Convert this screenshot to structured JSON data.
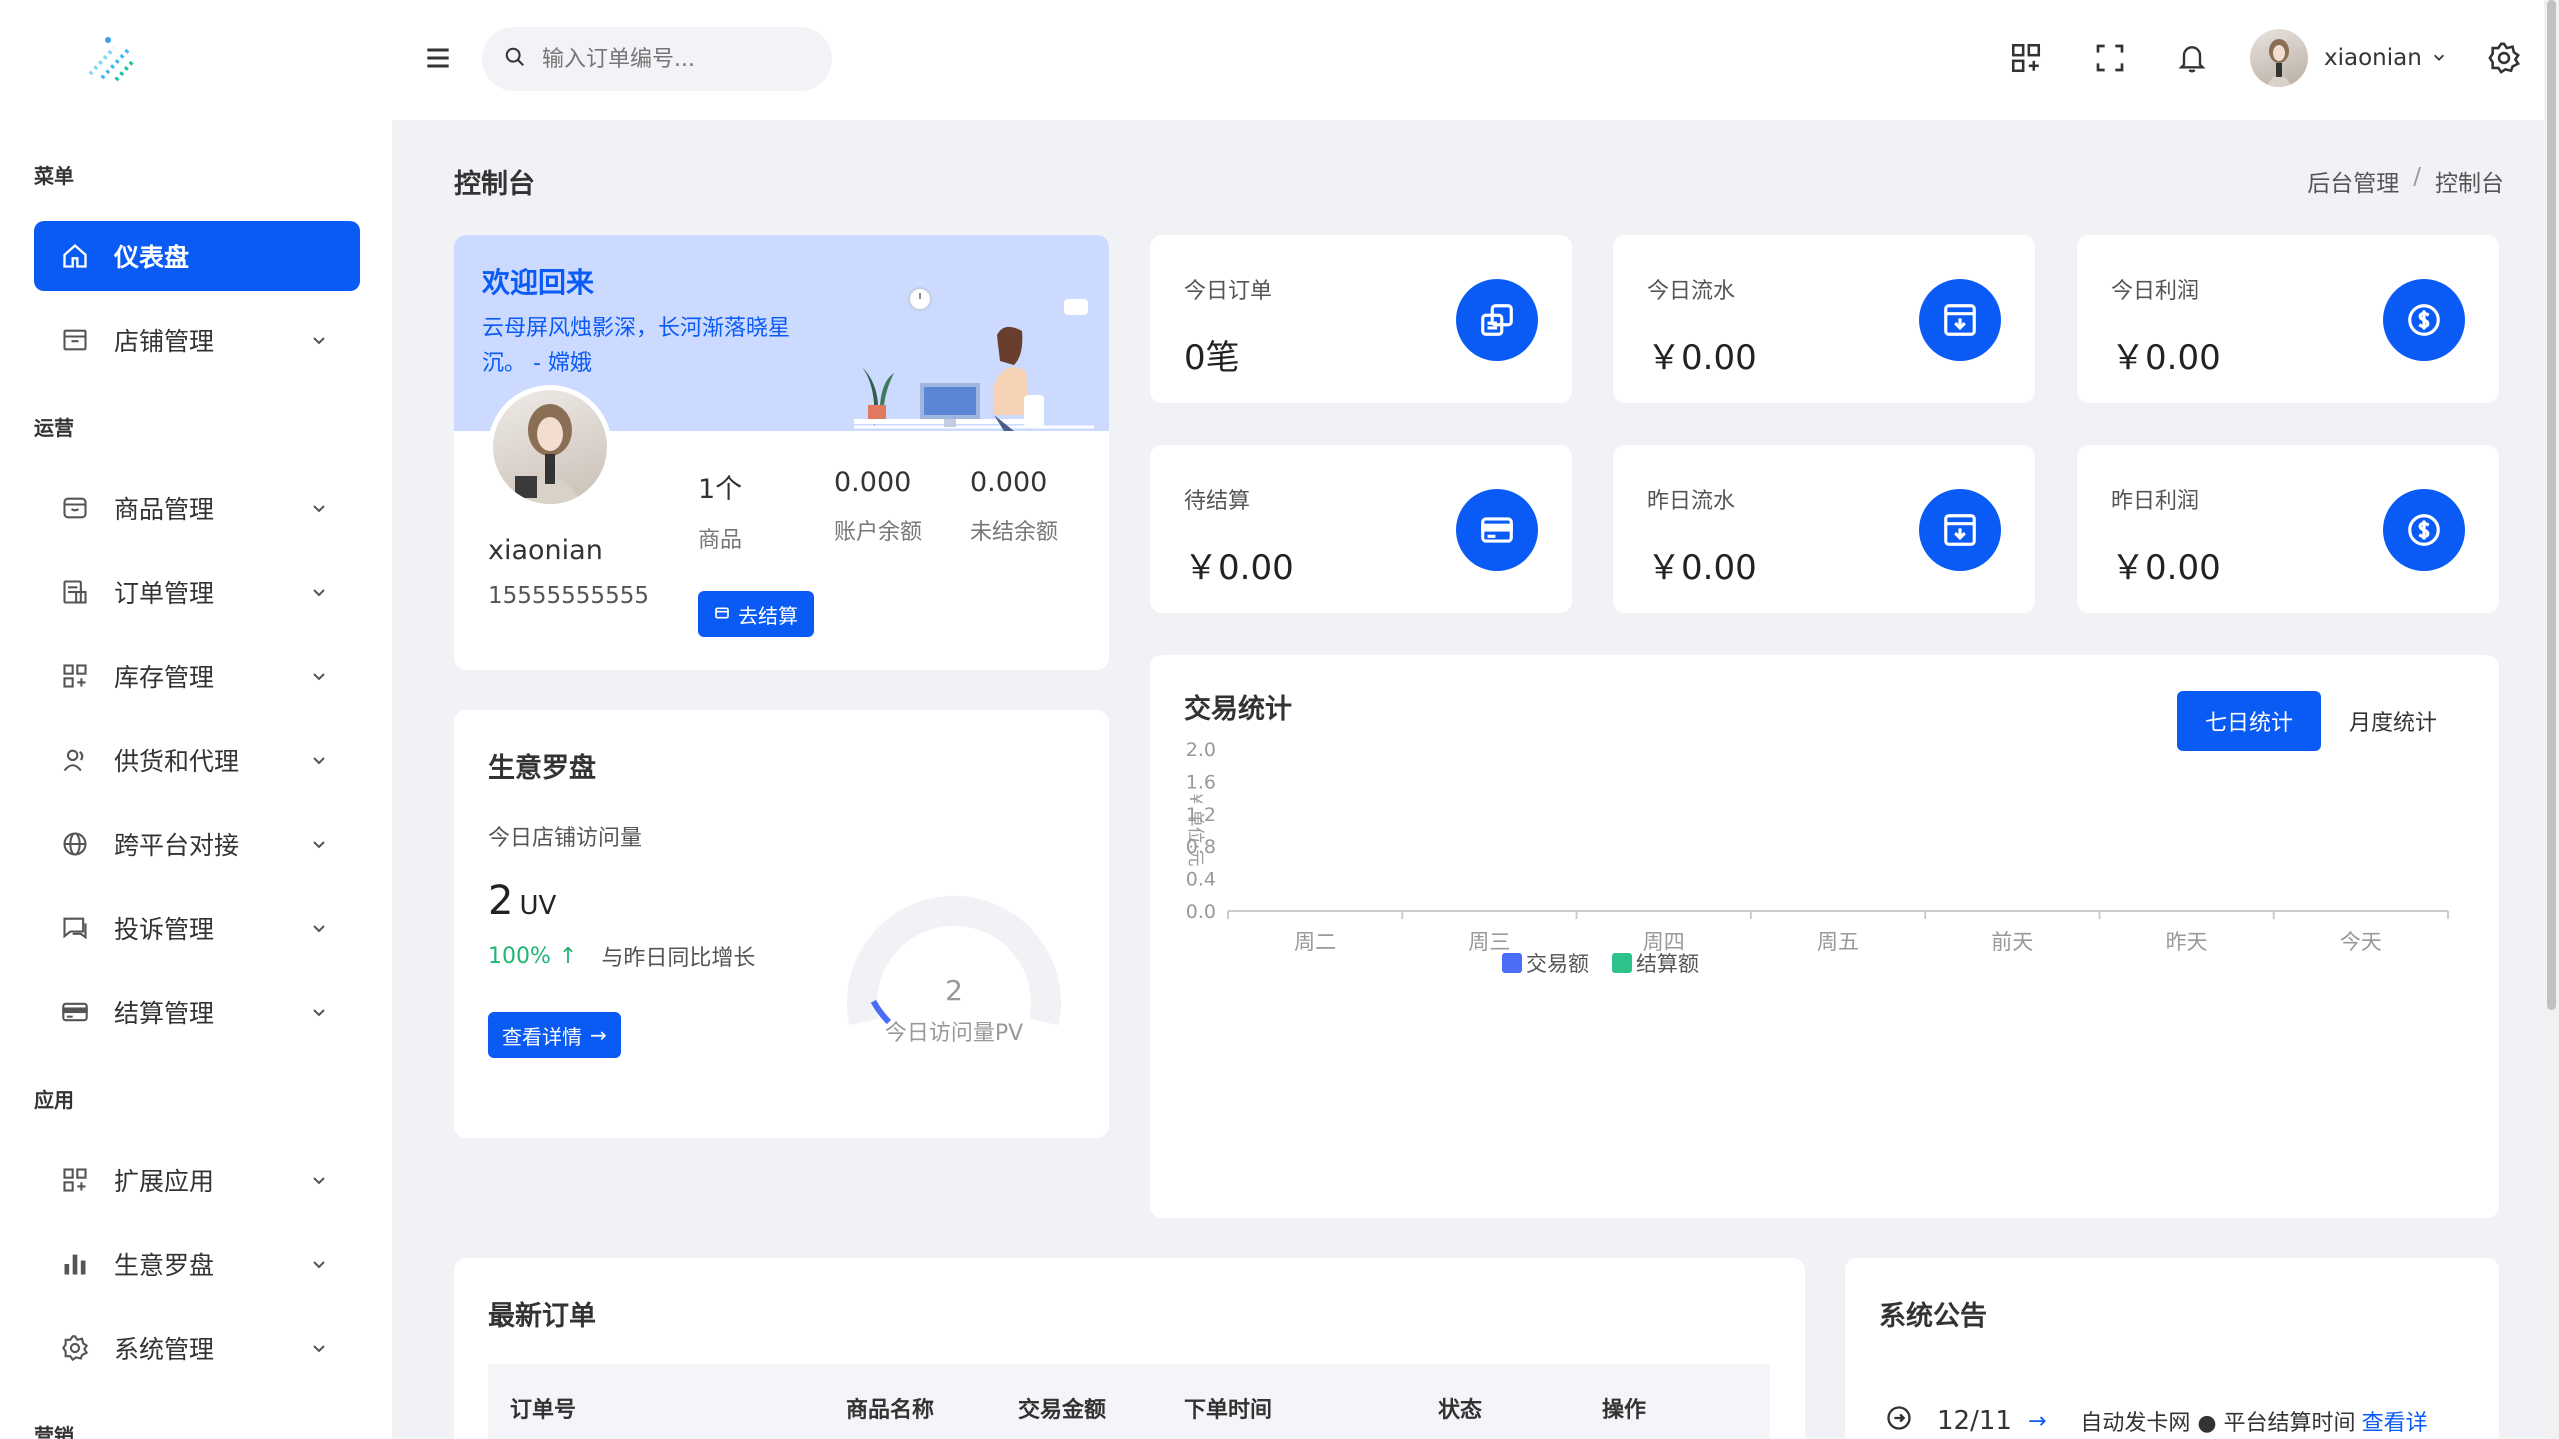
{
  "sidebar": {
    "groups": {
      "menu": "菜单",
      "ops": "运营",
      "apps": "应用",
      "marketing": "营销"
    },
    "items": [
      {
        "label": "仪表盘",
        "icon": "home-icon"
      },
      {
        "label": "店铺管理",
        "icon": "store-icon"
      },
      {
        "label": "商品管理",
        "icon": "box-icon"
      },
      {
        "label": "订单管理",
        "icon": "order-icon"
      },
      {
        "label": "库存管理",
        "icon": "grid-icon"
      },
      {
        "label": "供货和代理",
        "icon": "users-icon"
      },
      {
        "label": "跨平台对接",
        "icon": "globe-icon"
      },
      {
        "label": "投诉管理",
        "icon": "chat-icon"
      },
      {
        "label": "结算管理",
        "icon": "card-icon"
      },
      {
        "label": "扩展应用",
        "icon": "apps-icon"
      },
      {
        "label": "生意罗盘",
        "icon": "bar-chart-icon"
      },
      {
        "label": "系统管理",
        "icon": "gear-icon"
      }
    ]
  },
  "header": {
    "search_placeholder": "输入订单编号...",
    "username": "xiaonian"
  },
  "page": {
    "title": "控制台",
    "breadcrumb": [
      "后台管理",
      "控制台"
    ]
  },
  "welcome": {
    "title": "欢迎回来",
    "quote": "云母屏风烛影深，长河渐落晓星沉。 - 嫦娥",
    "name": "xiaonian",
    "phone": "15555555555",
    "stats": [
      {
        "value": "1个",
        "label": "商品"
      },
      {
        "value": "0.000",
        "label": "账户余额"
      },
      {
        "value": "0.000",
        "label": "未结余额"
      }
    ],
    "settle_button": "去结算"
  },
  "kpis": [
    {
      "title": "今日订单",
      "value": "0笔",
      "icon": "copy-icon"
    },
    {
      "title": "今日流水",
      "value": "￥0.00",
      "icon": "archive-icon"
    },
    {
      "title": "今日利润",
      "value": "￥0.00",
      "icon": "dollar-icon"
    },
    {
      "title": "待结算",
      "value": "￥0.00",
      "icon": "card-icon"
    },
    {
      "title": "昨日流水",
      "value": "￥0.00",
      "icon": "archive-icon"
    },
    {
      "title": "昨日利润",
      "value": "￥0.00",
      "icon": "dollar-icon"
    }
  ],
  "compass": {
    "title": "生意罗盘",
    "subtitle": "今日店铺访问量",
    "uv_value": "2",
    "uv_unit": "UV",
    "growth_pct": "100%",
    "growth_text": "与昨日同比增长",
    "detail_button": "查看详情",
    "gauge_value": "2",
    "gauge_label": "今日访问量PV",
    "gauge_fraction": 0.02
  },
  "trade": {
    "title": "交易统计",
    "tabs": [
      "七日统计",
      "月度统计"
    ],
    "colors": {
      "series1": "#4a6cf7",
      "series2": "#2ec28b",
      "axis": "#999999"
    }
  },
  "chart_data": {
    "type": "bar",
    "categories": [
      "周二",
      "周三",
      "周四",
      "周五",
      "前天",
      "昨天",
      "今天"
    ],
    "series": [
      {
        "name": "交易额",
        "values": [
          0,
          0,
          0,
          0,
          0,
          0,
          0
        ]
      },
      {
        "name": "结算额",
        "values": [
          0,
          0,
          0,
          0,
          0,
          0,
          0
        ]
      }
    ],
    "ylabel": "¥ 单位:元",
    "yticks": [
      "0.0",
      "0.4",
      "0.8",
      "1.2",
      "1.6",
      "2.0"
    ],
    "ylim": [
      0,
      2.0
    ],
    "grid": false,
    "legend": "bottom"
  },
  "orders": {
    "title": "最新订单",
    "columns": [
      "订单号",
      "商品名称",
      "交易金额",
      "下单时间",
      "状态",
      "操作"
    ]
  },
  "notice": {
    "title": "系统公告",
    "date": "12/11",
    "text": "自动发卡网 ● 平台结算时间",
    "link": "查看详"
  }
}
